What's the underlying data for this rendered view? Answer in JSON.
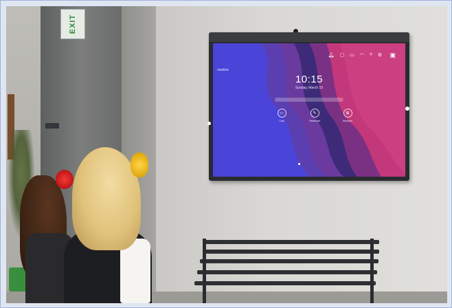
{
  "scene": {
    "exit_sign": {
      "text": "EXIT"
    },
    "display": {
      "brand": "newline",
      "time": "10:15",
      "date": "Sunday, March 10",
      "status_icons": [
        "bell-icon",
        "lock-icon",
        "cast-icon",
        "wifi-icon",
        "help-icon",
        "settings-icon"
      ],
      "apps": [
        {
          "label": "Cast",
          "icon": "cast-icon"
        },
        {
          "label": "Viewboard",
          "icon": "whiteboard-icon"
        },
        {
          "label": "Windows",
          "icon": "windows-icon"
        }
      ]
    }
  },
  "colors": {
    "screen_blue": "#4a44d8",
    "screen_purple": "#5a3f9a",
    "screen_magenta": "#c2387a",
    "bow_red": "#d01c1c",
    "bow_yellow": "#f1c021"
  }
}
